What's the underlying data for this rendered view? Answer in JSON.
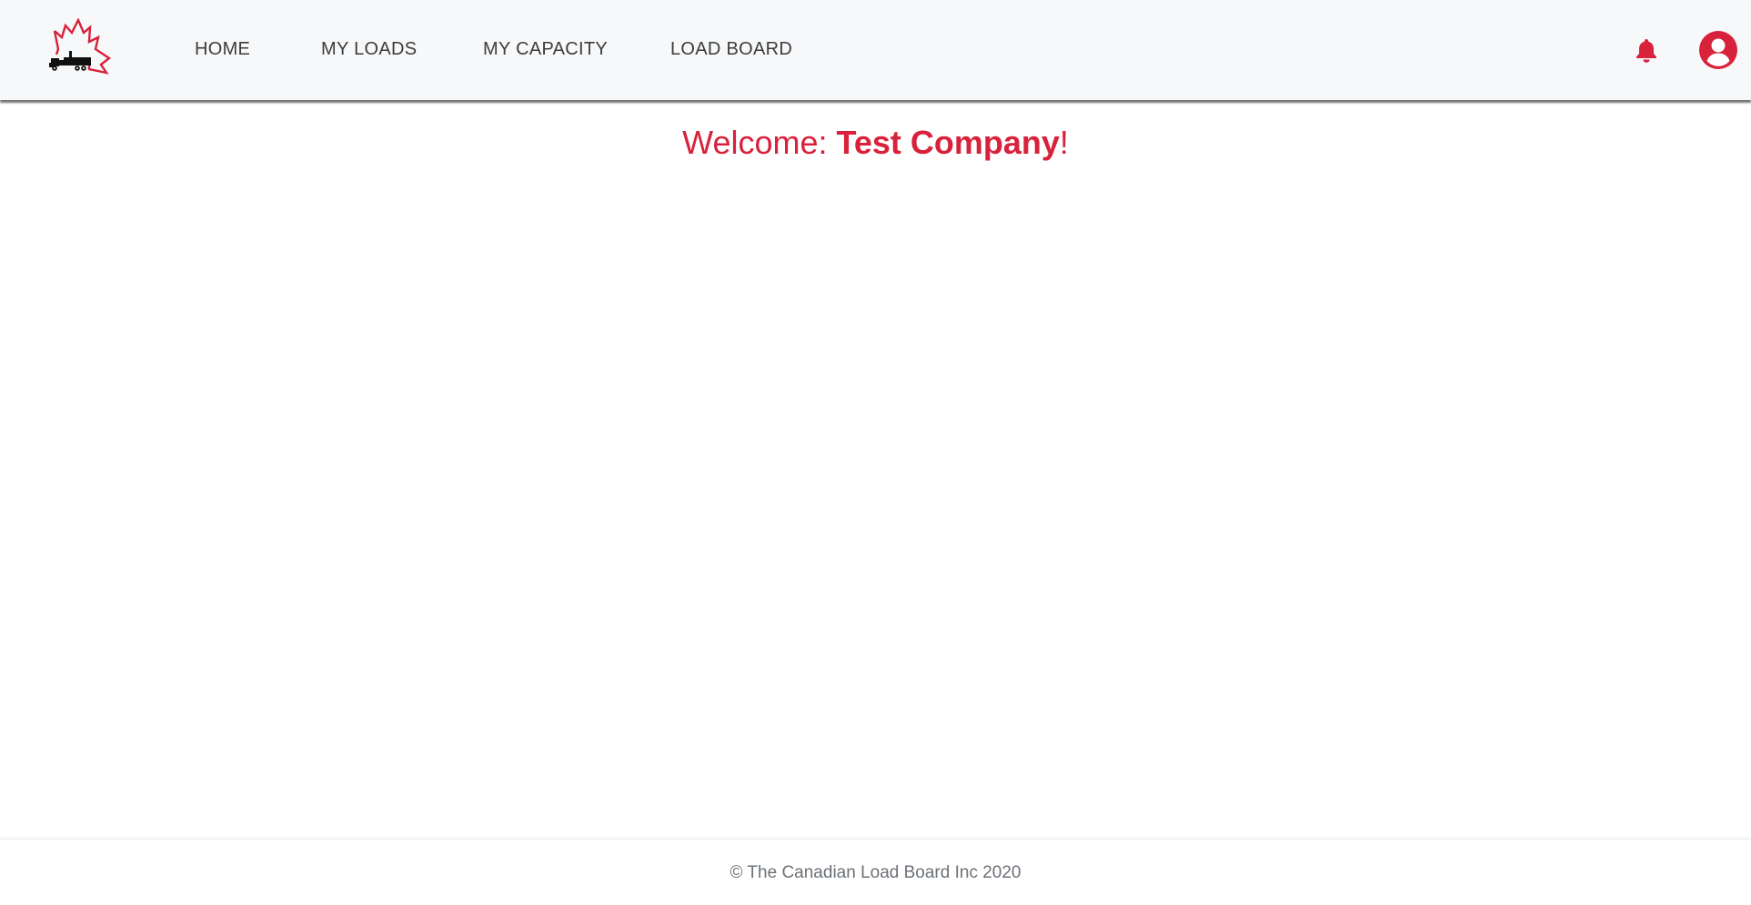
{
  "brand": {
    "logo_icon": "maple-leaf-truck-icon",
    "accent_color": "#d8213a"
  },
  "nav": {
    "items": [
      {
        "label": "HOME"
      },
      {
        "label": "MY LOADS"
      },
      {
        "label": "MY CAPACITY"
      },
      {
        "label": "LOAD BOARD"
      }
    ],
    "notifications_icon": "bell-icon",
    "account_icon": "user-circle-icon"
  },
  "welcome": {
    "prefix": "Welcome: ",
    "company": "Test Company",
    "suffix": "!"
  },
  "footer": {
    "copyright": "© The Canadian Load Board Inc 2020"
  }
}
